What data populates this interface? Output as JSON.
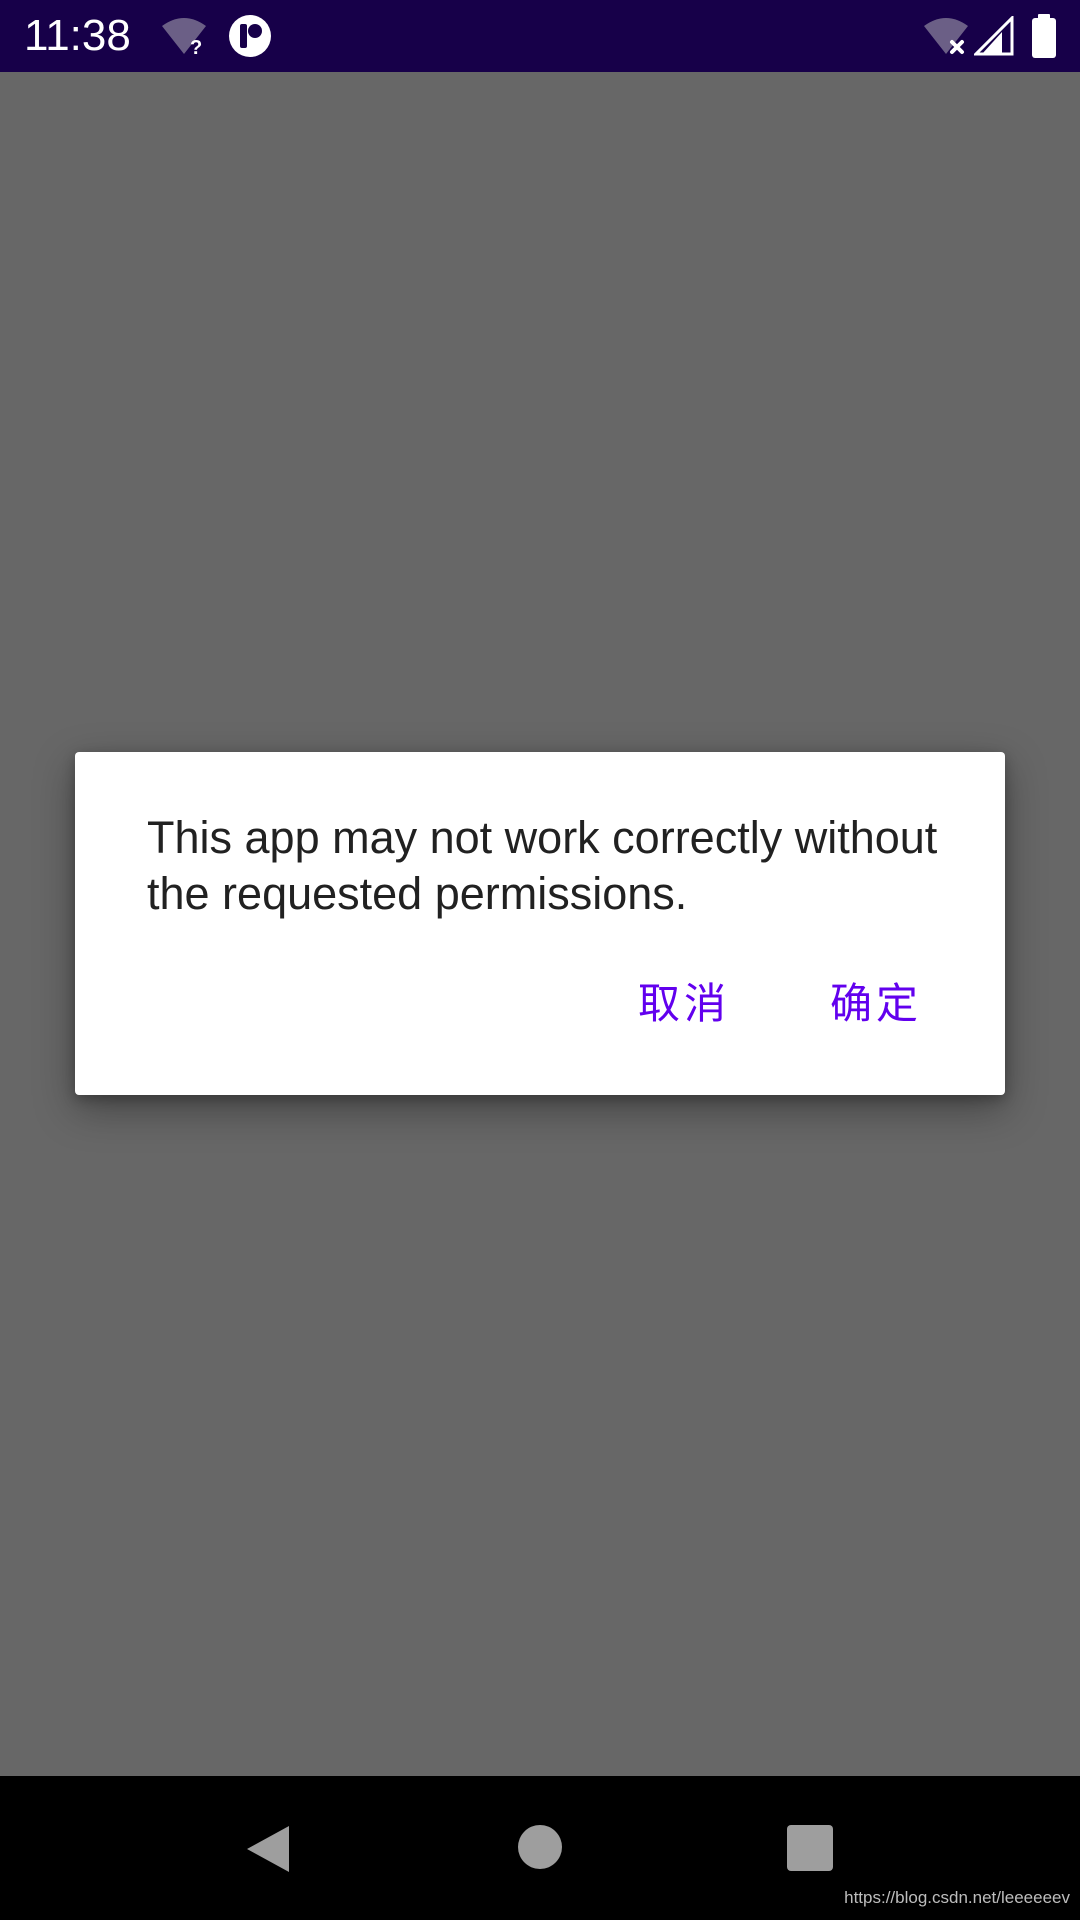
{
  "status_bar": {
    "time": "11:38",
    "wifi_unknown_icon": "wifi-question-icon",
    "app_notification_icon": "app-logo-icon",
    "wifi_off_icon": "wifi-off-icon",
    "signal_icon": "cell-signal-icon",
    "battery_icon": "battery-icon",
    "background_color": "#170049"
  },
  "dialog": {
    "message": "This app may not work correctly without the requested permissions.",
    "cancel_label": "取消",
    "ok_label": "确定",
    "accent_color": "#6200ee"
  },
  "nav_bar": {
    "back_icon": "back-triangle-icon",
    "home_icon": "home-circle-icon",
    "recents_icon": "recents-square-icon"
  },
  "watermark": "https://blog.csdn.net/leeeeeev"
}
